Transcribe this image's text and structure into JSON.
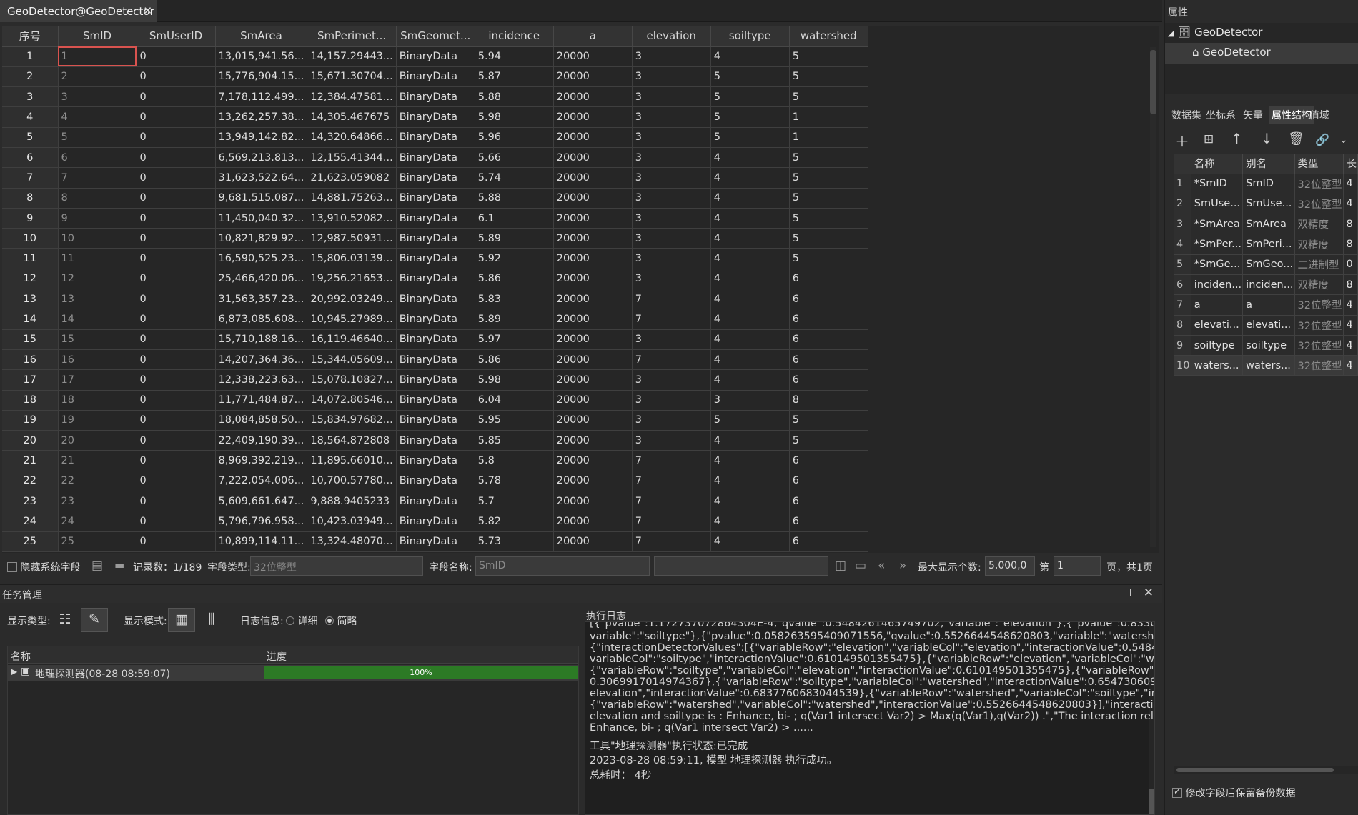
{
  "tab": {
    "title": "GeoDetector@GeoDetector",
    "close": "✕"
  },
  "grid": {
    "columns": [
      "序号",
      "SmID",
      "SmUserID",
      "SmArea",
      "SmPerimet...",
      "SmGeomet...",
      "incidence",
      "a",
      "elevation",
      "soiltype",
      "watershed"
    ],
    "rows": [
      [
        "1",
        "1",
        "0",
        "13,015,941.56...",
        "14,157.29443...",
        "BinaryData",
        "5.94",
        "20000",
        "3",
        "4",
        "5"
      ],
      [
        "2",
        "2",
        "0",
        "15,776,904.15...",
        "15,671.30704...",
        "BinaryData",
        "5.87",
        "20000",
        "3",
        "5",
        "5"
      ],
      [
        "3",
        "3",
        "0",
        "7,178,112.499...",
        "12,384.47581...",
        "BinaryData",
        "5.88",
        "20000",
        "3",
        "5",
        "5"
      ],
      [
        "4",
        "4",
        "0",
        "13,262,257.38...",
        "14,305.467675",
        "BinaryData",
        "5.98",
        "20000",
        "3",
        "5",
        "1"
      ],
      [
        "5",
        "5",
        "0",
        "13,949,142.82...",
        "14,320.64866...",
        "BinaryData",
        "5.96",
        "20000",
        "3",
        "5",
        "1"
      ],
      [
        "6",
        "6",
        "0",
        "6,569,213.813...",
        "12,155.41344...",
        "BinaryData",
        "5.66",
        "20000",
        "3",
        "4",
        "5"
      ],
      [
        "7",
        "7",
        "0",
        "31,623,522.64...",
        "21,623.059082",
        "BinaryData",
        "5.74",
        "20000",
        "3",
        "4",
        "5"
      ],
      [
        "8",
        "8",
        "0",
        "9,681,515.087...",
        "14,881.75263...",
        "BinaryData",
        "5.88",
        "20000",
        "3",
        "4",
        "5"
      ],
      [
        "9",
        "9",
        "0",
        "11,450,040.32...",
        "13,910.52082...",
        "BinaryData",
        "6.1",
        "20000",
        "3",
        "4",
        "5"
      ],
      [
        "10",
        "10",
        "0",
        "10,821,829.92...",
        "12,987.50931...",
        "BinaryData",
        "5.89",
        "20000",
        "3",
        "4",
        "5"
      ],
      [
        "11",
        "11",
        "0",
        "16,590,525.23...",
        "15,806.03139...",
        "BinaryData",
        "5.92",
        "20000",
        "3",
        "4",
        "5"
      ],
      [
        "12",
        "12",
        "0",
        "25,466,420.06...",
        "19,256.21653...",
        "BinaryData",
        "5.86",
        "20000",
        "3",
        "4",
        "6"
      ],
      [
        "13",
        "13",
        "0",
        "31,563,357.23...",
        "20,992.03249...",
        "BinaryData",
        "5.83",
        "20000",
        "7",
        "4",
        "6"
      ],
      [
        "14",
        "14",
        "0",
        "6,873,085.608...",
        "10,945.27989...",
        "BinaryData",
        "5.89",
        "20000",
        "7",
        "4",
        "6"
      ],
      [
        "15",
        "15",
        "0",
        "15,710,188.16...",
        "16,119.46640...",
        "BinaryData",
        "5.97",
        "20000",
        "3",
        "4",
        "6"
      ],
      [
        "16",
        "16",
        "0",
        "14,207,364.36...",
        "15,344.05609...",
        "BinaryData",
        "5.86",
        "20000",
        "7",
        "4",
        "6"
      ],
      [
        "17",
        "17",
        "0",
        "12,338,223.63...",
        "15,078.10827...",
        "BinaryData",
        "5.98",
        "20000",
        "3",
        "4",
        "6"
      ],
      [
        "18",
        "18",
        "0",
        "11,771,484.87...",
        "14,072.80546...",
        "BinaryData",
        "6.04",
        "20000",
        "3",
        "3",
        "8"
      ],
      [
        "19",
        "19",
        "0",
        "18,084,858.50...",
        "15,834.97682...",
        "BinaryData",
        "5.95",
        "20000",
        "3",
        "5",
        "5"
      ],
      [
        "20",
        "20",
        "0",
        "22,409,190.39...",
        "18,564.872808",
        "BinaryData",
        "5.85",
        "20000",
        "3",
        "4",
        "5"
      ],
      [
        "21",
        "21",
        "0",
        "8,969,392.219...",
        "11,895.66010...",
        "BinaryData",
        "5.8",
        "20000",
        "7",
        "4",
        "6"
      ],
      [
        "22",
        "22",
        "0",
        "7,222,054.006...",
        "10,700.57780...",
        "BinaryData",
        "5.78",
        "20000",
        "7",
        "4",
        "6"
      ],
      [
        "23",
        "23",
        "0",
        "5,609,661.647...",
        "9,888.9405233",
        "BinaryData",
        "5.7",
        "20000",
        "7",
        "4",
        "6"
      ],
      [
        "24",
        "24",
        "0",
        "5,796,796.958...",
        "10,423.03949...",
        "BinaryData",
        "5.82",
        "20000",
        "7",
        "4",
        "6"
      ],
      [
        "25",
        "25",
        "0",
        "10,899,114.11...",
        "13,324.48070...",
        "BinaryData",
        "5.73",
        "20000",
        "7",
        "4",
        "6"
      ]
    ]
  },
  "status": {
    "hide_system_fields": "隐藏系统字段",
    "records_label": "记录数：",
    "records_value": "1/189",
    "field_type_label": "字段类型:",
    "field_type_value": "32位整型",
    "field_name_label": "字段名称:",
    "field_name_value": "SmID",
    "max_display_label": "最大显示个数:",
    "max_display_value": "5,000,0",
    "page_prefix": "第",
    "page_value": "1",
    "page_suffix": "页，共1页"
  },
  "task": {
    "panel_title": "任务管理",
    "display_type_label": "显示类型:",
    "display_mode_label": "显示模式:",
    "log_info_label": "日志信息:",
    "log_detail": "详细",
    "log_brief": "简略",
    "col_name": "名称",
    "col_progress": "进度",
    "task_name": "地理探测器(08-28 08:59:07)",
    "progress": 100,
    "progress_text": "100%"
  },
  "log": {
    "title": "执行日志",
    "lines": [
      "[{\"pvalue\":1.172737072864304E-4,\"qvalue\":0.5484261465749702,\"variable\":\"elevation\"},{\"pvalue\":0.8330174225632071",
      "variable\":\"soiltype\"},{\"pvalue\":0.058263595409071556,\"qvalue\":0.5526644548620803,\"variable\":\"watershed\"}],\"interacti",
      "{\"interactionDetectorValues\":[{\"variableRow\":\"elevation\",\"variableCol\":\"elevation\",\"interactionValue\":0.5484261465749",
      "variableCol\":\"soiltype\",\"interactionValue\":0.610149501355475},{\"variableRow\":\"elevation\",\"variableCol\":\"watershed\",\"ir",
      "{\"variableRow\":\"soiltype\",\"variableCol\":\"elevation\",\"interactionValue\":0.610149501355475},{\"variableRow\":\"soiltype\",\"va",
      "0.3069917014974367},{\"variableRow\":\"soiltype\",\"variableCol\":\"watershed\",\"interactionValue\":0.654730609729326},{\"var",
      "elevation\",\"interactionValue\":0.6837760683044539},{\"variableRow\":\"watershed\",\"variableCol\":\"soiltype\",\"interactionVa",
      "{\"variableRow\":\"watershed\",\"variableCol\":\"watershed\",\"interactionValue\":0.5526644548620803}],\"interactionDescriptio",
      "elevation and soiltype is : Enhance, bi- ; q(Var1 intersect Var2) > Max(q(Var1),q(Var2)) .\",\"The interaction relationship",
      "Enhance, bi- ; q(Var1 intersect Var2) > ......",
      "工具\"地理探测器\"执行状态:已完成",
      "2023-08-28 08:59:11,  模型 地理探测器 执行成功。",
      "总耗时：  4秒"
    ]
  },
  "props": {
    "title": "属性",
    "tree_root": "GeoDetector",
    "tree_child": "GeoDetector",
    "tabs": [
      "数据集",
      "坐标系",
      "矢量",
      "属性结构",
      "值域"
    ],
    "active_tab": "属性结构",
    "columns": [
      "",
      "名称",
      "别名",
      "类型",
      "长"
    ],
    "fields": [
      [
        "1",
        "*SmID",
        "SmID",
        "32位整型",
        "4"
      ],
      [
        "2",
        "SmUse...",
        "SmUse...",
        "32位整型",
        "4"
      ],
      [
        "3",
        "*SmArea",
        "SmArea",
        "双精度",
        "8"
      ],
      [
        "4",
        "*SmPer...",
        "SmPeri...",
        "双精度",
        "8"
      ],
      [
        "5",
        "*SmGe...",
        "SmGeo...",
        "二进制型",
        "0"
      ],
      [
        "6",
        "inciden...",
        "inciden...",
        "双精度",
        "8"
      ],
      [
        "7",
        "a",
        "a",
        "32位整型",
        "4"
      ],
      [
        "8",
        "elevati...",
        "elevati...",
        "32位整型",
        "4"
      ],
      [
        "9",
        "soiltype",
        "soiltype",
        "32位整型",
        "4"
      ],
      [
        "10",
        "waters...",
        "waters...",
        "32位整型",
        "4"
      ]
    ],
    "backup_label": "修改字段后保留备份数据"
  }
}
